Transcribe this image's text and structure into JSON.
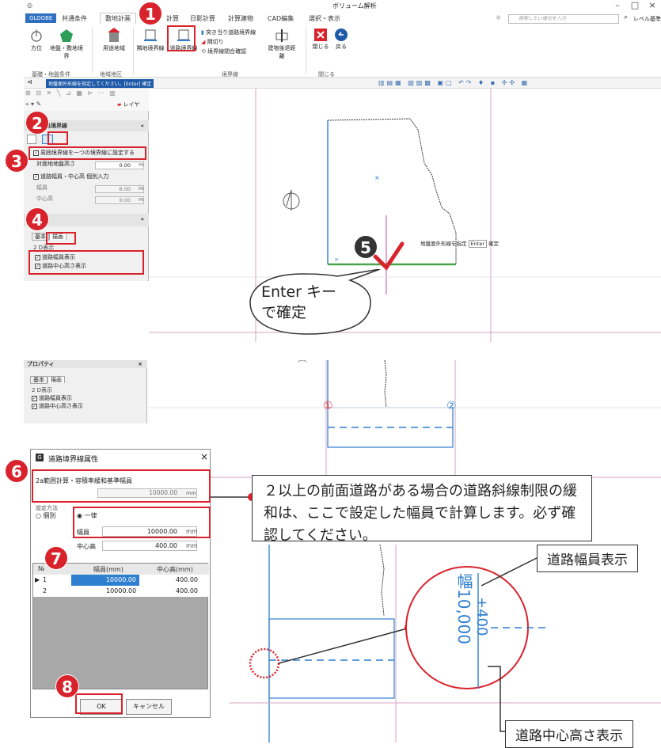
{
  "window": {
    "title": "ボリューム解析",
    "min": "–",
    "max": "□",
    "close": "×"
  },
  "ribbon": {
    "tabs": [
      "GLOOBE",
      "共通条件",
      "敷地計画",
      "計算",
      "日影計算",
      "計算建物",
      "CAD編集",
      "選択・表示"
    ],
    "search_placeholder": "検索したい語句を入力",
    "level_label": "レベル基準：CAD基準",
    "buttons": {
      "hoi": "方位",
      "chi": "地盤・敷地境界",
      "youto": "用途地域",
      "rinchi": "隣地境界線",
      "douro": "道路境界線",
      "tsukiatari": "突き当り道路境界線",
      "sumikiri": "隅切り",
      "heigou": "境界線閉合確認",
      "kouchi": "建物後退距離",
      "close": "閉じる",
      "back": "戻る"
    },
    "groups": {
      "g1": "基礎・地盤条件",
      "g2": "地域地区",
      "g3": "境界線",
      "g4": "閉じる"
    }
  },
  "status": {
    "prompt": "地盤面外形線を指定してください。[Enter] 確定"
  },
  "panel1": {
    "layer": "レイヤ",
    "section_title": "道路境界線",
    "set_one_line": "周囲境界線を一つの境界線に設定する",
    "ground_height_label": "対面地地盤高さ",
    "ground_height_value": "0.00",
    "unit_m": "m",
    "individual_input": "道路幅員・中心高 個別入力",
    "width_label": "幅員",
    "width_value": "6.00",
    "center_label": "中心高",
    "center_value": "0.00",
    "tab_basic": "基本",
    "tab_draw": "描画",
    "section_2d": "2 D表示",
    "show_width": "道路幅員表示",
    "show_center": "道路中心高さ表示"
  },
  "canvas_top": {
    "tooltip": "地盤面外形線を指定",
    "tooltip_key": "Enter",
    "tooltip_confirm": "確定",
    "speech": "Enter キー\nで確定"
  },
  "panel2": {
    "title": "プロパティ",
    "tab_basic": "基本",
    "tab_draw": "描画",
    "section_2d": "2 D表示",
    "show_width": "道路幅員表示",
    "show_center": "道路中心高さ表示"
  },
  "dialog": {
    "title": "道路境界線属性",
    "calc_label": "2a範囲計算・容積率緩和基準幅員",
    "calc_value": "10000.00",
    "unit_mm": "mm",
    "method_label": "設定方法",
    "opt_individual": "個別",
    "opt_uniform": "一律",
    "width_label": "幅員",
    "width_value": "10000.00",
    "center_label": "中心高",
    "center_value": "400.00",
    "col_no": "№",
    "col_width": "幅員(mm)",
    "col_center": "中心高(mm)",
    "rows": [
      {
        "no": "1",
        "width": "10000.00",
        "center": "400.00"
      },
      {
        "no": "2",
        "width": "10000.00",
        "center": "400.00"
      }
    ],
    "ok": "OK",
    "cancel": "キャンセル"
  },
  "callout": {
    "text": "２以上の前面道路がある場合の道路斜線制限の緩和は、ここで設定した幅員で計算します。必ず確認してください。"
  },
  "zoom": {
    "width_text": "幅10,000",
    "height_text": "+400",
    "label_width": "道路幅員表示",
    "label_center": "道路中心高さ表示"
  },
  "markers": {
    "one": "①",
    "two": "②"
  },
  "steps": [
    "1",
    "2",
    "3",
    "4",
    "5",
    "6",
    "7",
    "8"
  ]
}
